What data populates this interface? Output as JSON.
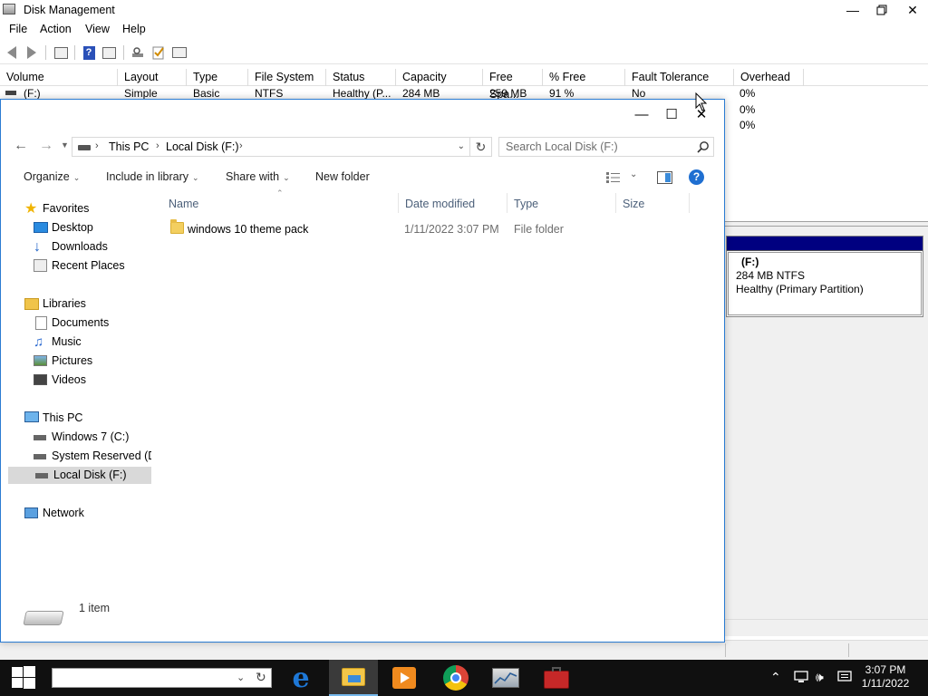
{
  "disk_mgmt": {
    "title": "Disk Management",
    "menu": [
      "File",
      "Action",
      "View",
      "Help"
    ],
    "columns": [
      "Volume",
      "Layout",
      "Type",
      "File System",
      "Status",
      "Capacity",
      "Free Spa...",
      "% Free",
      "Fault Tolerance",
      "Overhead"
    ],
    "row": {
      "volume": "(F:)",
      "layout": "Simple",
      "type": "Basic",
      "file_system": "NTFS",
      "status": "Healthy (P...",
      "capacity": "284 MB",
      "free_space": "259 MB",
      "percent_free": "91 %",
      "fault_tolerance": "No",
      "overhead": "0%"
    },
    "extra_overhead": [
      "0%",
      "0%"
    ],
    "partition": {
      "label": "(F:)",
      "size": "284 MB NTFS",
      "status": "Healthy (Primary Partition)",
      "bar_color": "#000080"
    }
  },
  "explorer": {
    "breadcrumb": [
      "This PC",
      "Local Disk (F:)"
    ],
    "search_placeholder": "Search Local Disk (F:)",
    "commands": {
      "organize": "Organize",
      "include": "Include in library",
      "share": "Share with",
      "new_folder": "New folder"
    },
    "nav": {
      "favorites": "Favorites",
      "desktop": "Desktop",
      "downloads": "Downloads",
      "recent": "Recent Places",
      "libraries": "Libraries",
      "documents": "Documents",
      "music": "Music",
      "pictures": "Pictures",
      "videos": "Videos",
      "this_pc": "This PC",
      "win7": "Windows 7 (C:)",
      "sysres": "System Reserved (D:",
      "localf": "Local Disk (F:)",
      "network": "Network"
    },
    "list_headers": [
      "Name",
      "Date modified",
      "Type",
      "Size"
    ],
    "items": [
      {
        "name": "windows 10 theme pack",
        "date": "1/11/2022 3:07 PM",
        "type": "File folder",
        "size": ""
      }
    ],
    "status_count": "1 item"
  },
  "taskbar": {
    "time": "3:07 PM",
    "date": "1/11/2022",
    "apps": [
      "edge-icon",
      "file-explorer-icon",
      "media-player-icon",
      "chrome-icon",
      "server-manager-icon",
      "toolbox-icon"
    ]
  }
}
